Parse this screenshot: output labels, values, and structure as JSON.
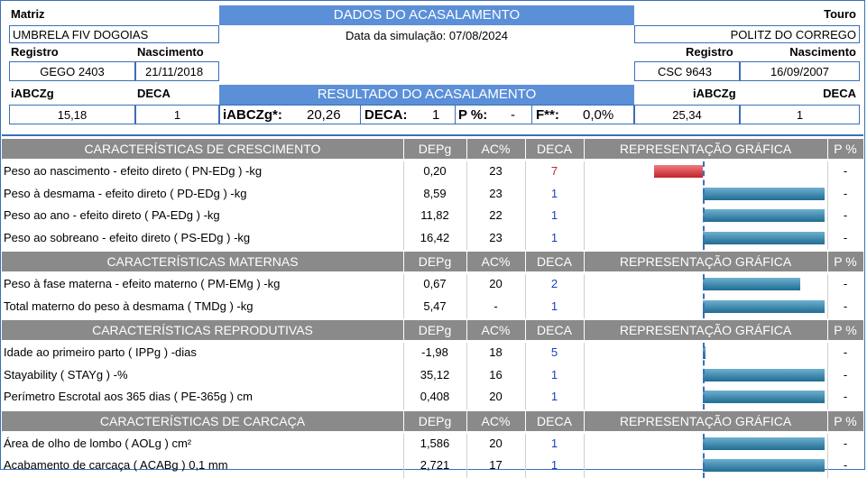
{
  "header": {
    "matriz_label": "Matriz",
    "touro_label": "Touro",
    "dados_title": "DADOS DO ACASALAMENTO",
    "simulation_date": "Data da simulação: 07/08/2024",
    "matriz_name": "UMBRELA FIV DOGOIAS",
    "touro_name": "POLITZ DO CORREGO",
    "registro_label": "Registro",
    "nascimento_label": "Nascimento",
    "matriz_registro": "GEGO 2403",
    "matriz_nascimento": "21/11/2018",
    "touro_registro": "CSC 9643",
    "touro_nascimento": "16/09/2007",
    "iabczg_label": "iABCZg",
    "deca_label": "DECA",
    "matriz_iabczg": "15,18",
    "matriz_deca": "1",
    "touro_iabczg": "25,34",
    "touro_deca": "1",
    "resultado_title": "RESULTADO DO ACASALAMENTO",
    "result_iabczg_label": "iABCZg*:",
    "result_iabczg_value": "20,26",
    "result_deca_label": "DECA:",
    "result_deca_value": "1",
    "result_p_label": "P %:",
    "result_p_value": "-",
    "result_f_label": "F**:",
    "result_f_value": "0,0%"
  },
  "columns": {
    "depg": "DEPg",
    "ac": "AC%",
    "deca": "DECA",
    "rep": "REPRESENTAÇÃO GRÁFICA",
    "p": "P %"
  },
  "sections": [
    {
      "title": "CARACTERÍSTICAS DE CRESCIMENTO",
      "rows": [
        {
          "name": "Peso ao nascimento - efeito direto ( PN-EDg ) -kg",
          "depg": "0,20",
          "ac": "23",
          "deca": "7",
          "deca_color": "#c1222b",
          "bar": -0.4,
          "p": "-"
        },
        {
          "name": "Peso à desmama - efeito direto ( PD-EDg ) -kg",
          "depg": "8,59",
          "ac": "23",
          "deca": "1",
          "deca_color": "#1a3fbf",
          "bar": 1.0,
          "p": "-"
        },
        {
          "name": "Peso ao ano - efeito direto ( PA-EDg ) -kg",
          "depg": "11,82",
          "ac": "22",
          "deca": "1",
          "deca_color": "#1a3fbf",
          "bar": 1.0,
          "p": "-"
        },
        {
          "name": "Peso ao sobreano - efeito direto ( PS-EDg ) -kg",
          "depg": "16,42",
          "ac": "23",
          "deca": "1",
          "deca_color": "#1a3fbf",
          "bar": 1.0,
          "p": "-"
        }
      ]
    },
    {
      "title": "CARACTERÍSTICAS MATERNAS",
      "rows": [
        {
          "name": "Peso à fase materna - efeito materno ( PM-EMg ) -kg",
          "depg": "0,67",
          "ac": "20",
          "deca": "2",
          "deca_color": "#1a3fbf",
          "bar": 0.8,
          "p": "-"
        },
        {
          "name": "Total materno do peso à desmama ( TMDg ) -kg",
          "depg": "5,47",
          "ac": "-",
          "deca": "1",
          "deca_color": "#1a3fbf",
          "bar": 1.0,
          "p": "-"
        }
      ]
    },
    {
      "title": "CARACTERÍSTICAS REPRODUTIVAS",
      "rows": [
        {
          "name": "Idade ao primeiro parto ( IPPg ) -dias",
          "depg": "-1,98",
          "ac": "18",
          "deca": "5",
          "deca_color": "#1a3fbf",
          "bar": 0.02,
          "p": "-"
        },
        {
          "name": "Stayability ( STAYg ) -%",
          "depg": "35,12",
          "ac": "16",
          "deca": "1",
          "deca_color": "#1a3fbf",
          "bar": 1.0,
          "p": "-"
        },
        {
          "name": "Perímetro Escrotal aos 365 dias ( PE-365g ) cm",
          "depg": "0,408",
          "ac": "20",
          "deca": "1",
          "deca_color": "#1a3fbf",
          "bar": 1.0,
          "p": "-"
        }
      ]
    },
    {
      "title": "CARACTERÍSTICAS DE CARCAÇA",
      "rows": [
        {
          "name": "Área de olho de lombo ( AOLg ) cm²",
          "depg": "1,586",
          "ac": "20",
          "deca": "1",
          "deca_color": "#1a3fbf",
          "bar": 1.0,
          "p": "-"
        },
        {
          "name": "Acabamento de carcaça ( ACABg ) 0,1 mm",
          "depg": "2,721",
          "ac": "17",
          "deca": "1",
          "deca_color": "#1a3fbf",
          "bar": 1.0,
          "p": "-"
        }
      ]
    }
  ]
}
